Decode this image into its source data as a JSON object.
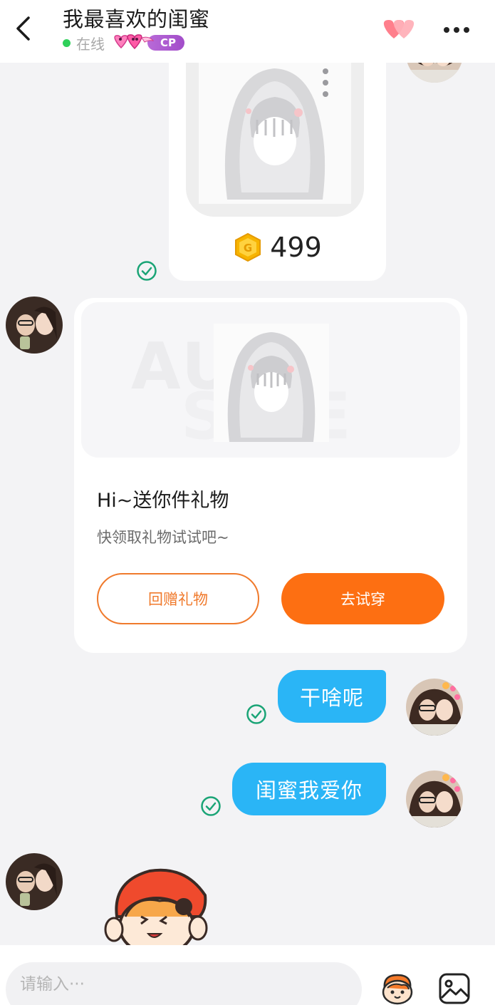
{
  "header": {
    "title": "我最喜欢的闺蜜",
    "status": "在线",
    "badge": "CP"
  },
  "messages": {
    "product": {
      "price": "499"
    },
    "gift": {
      "title": "Hi~送你件礼物",
      "subtitle": "快领取礼物试试吧~",
      "return_button": "回赠礼物",
      "try_button": "去试穿"
    },
    "text1": "干啥呢",
    "text2": "闺蜜我爱你"
  },
  "input": {
    "placeholder": "请输入···"
  },
  "colors": {
    "accent_orange": "#fd6f12",
    "bubble_blue": "#2ab5f6",
    "online_green": "#2fd05a",
    "read_check": "#1aa476",
    "cp_purple": "#a24dc9"
  }
}
